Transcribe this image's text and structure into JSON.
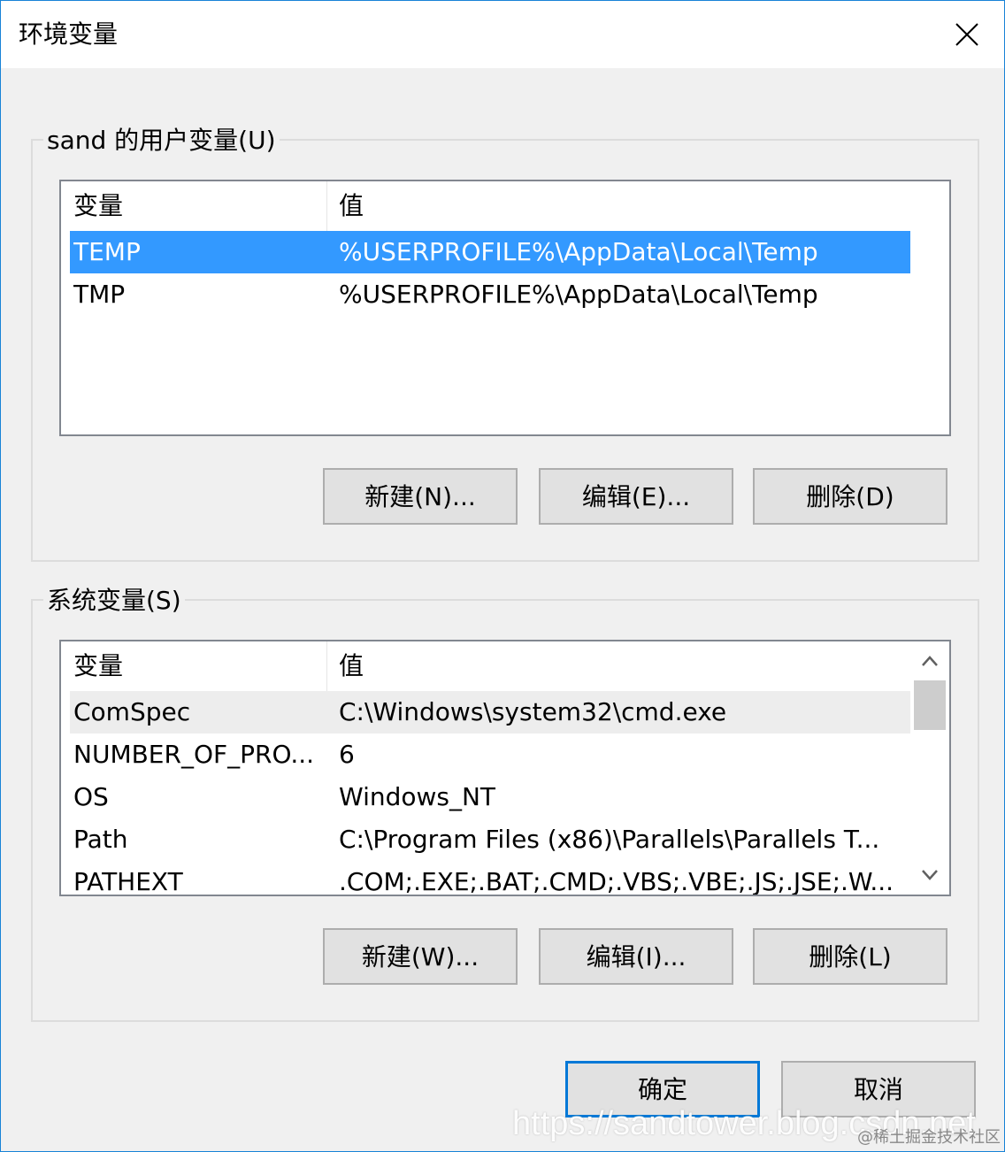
{
  "window": {
    "title": "环境变量",
    "close_glyph": "✕"
  },
  "user_vars": {
    "group_label": "sand 的用户变量(U)",
    "columns": [
      "变量",
      "值"
    ],
    "rows": [
      {
        "name": "TEMP",
        "value": "%USERPROFILE%\\AppData\\Local\\Temp",
        "selected": true
      },
      {
        "name": "TMP",
        "value": "%USERPROFILE%\\AppData\\Local\\Temp",
        "selected": false
      }
    ],
    "new_label": "新建(N)...",
    "edit_label": "编辑(E)...",
    "delete_label": "删除(D)"
  },
  "system_vars": {
    "group_label": "系统变量(S)",
    "columns": [
      "变量",
      "值"
    ],
    "rows": [
      {
        "name": "ComSpec",
        "value": "C:\\Windows\\system32\\cmd.exe",
        "hover": true
      },
      {
        "name": "NUMBER_OF_PRO...",
        "value": "6"
      },
      {
        "name": "OS",
        "value": "Windows_NT"
      },
      {
        "name": "Path",
        "value": "C:\\Program Files (x86)\\Parallels\\Parallels T..."
      },
      {
        "name": "PATHEXT",
        "value": ".COM;.EXE;.BAT;.CMD;.VBS;.VBE;.JS;.JSE;.W..."
      }
    ],
    "new_label": "新建(W)...",
    "edit_label": "编辑(I)...",
    "delete_label": "删除(L)"
  },
  "footer": {
    "ok_label": "确定",
    "cancel_label": "取消"
  },
  "watermark": {
    "url": "https://sandtower.blog.csdn.net",
    "credit": "@稀土掘金技术社区"
  },
  "colors": {
    "selection": "#3399ff",
    "window_border": "#1883d7",
    "default_button_border": "#0078d7"
  }
}
